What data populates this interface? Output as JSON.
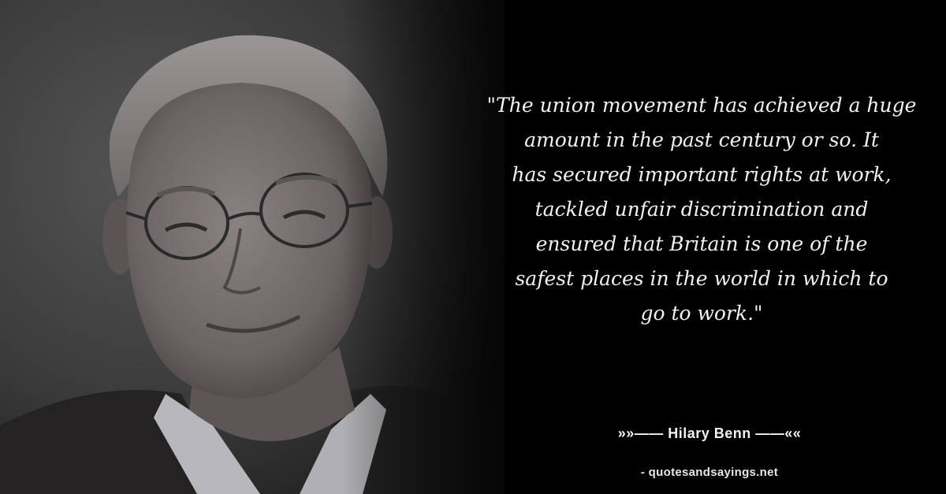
{
  "quote": {
    "lines": [
      "\"The union movement has achieved a huge",
      "amount in the past century or so. It",
      "has secured important rights at work,",
      "tackled unfair discrimination and",
      "ensured that Britain is one of the",
      "safest places in the world in which to",
      "go to work.\""
    ]
  },
  "author": {
    "text": "»»—— Hilary Benn ——««"
  },
  "source": {
    "text": "- quotesandsayings.net"
  },
  "colors": {
    "background": "#000000",
    "text": "#f2f2f2"
  }
}
